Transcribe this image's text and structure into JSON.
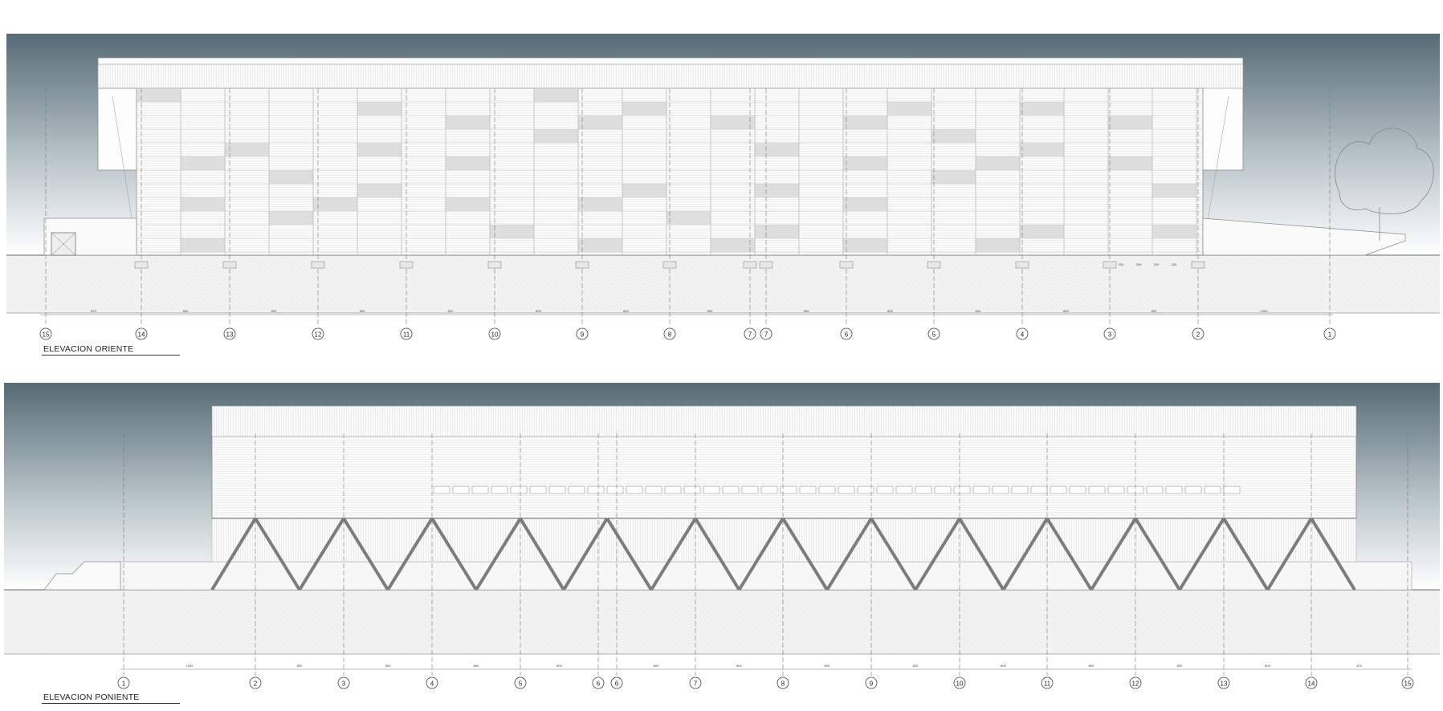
{
  "elevation_east": {
    "title": "ELEVACION ORIENTE",
    "axis_labels": [
      "15",
      "14",
      "13",
      "12",
      "11",
      "10",
      "9",
      "8",
      "7",
      "7",
      "6",
      "5",
      "4",
      "3",
      "2",
      "1"
    ],
    "bay_dimension": "800",
    "end_dimensions": [
      "870",
      "1200"
    ],
    "dim_notes": [
      "200",
      "200",
      "200",
      "200"
    ]
  },
  "elevation_west": {
    "title": "ELEVACION PONIENTE",
    "axis_labels": [
      "1",
      "2",
      "3",
      "4",
      "5",
      "6",
      "6",
      "7",
      "8",
      "9",
      "10",
      "11",
      "12",
      "13",
      "14",
      "15"
    ],
    "bay_dimension": "800",
    "end_dimensions": [
      "1200",
      "870"
    ]
  },
  "colors": {
    "sky_top": "#5a6f7a",
    "sky_bottom": "#ffffff",
    "line": "#6e6e6e",
    "ground": "#f2f2f2"
  }
}
